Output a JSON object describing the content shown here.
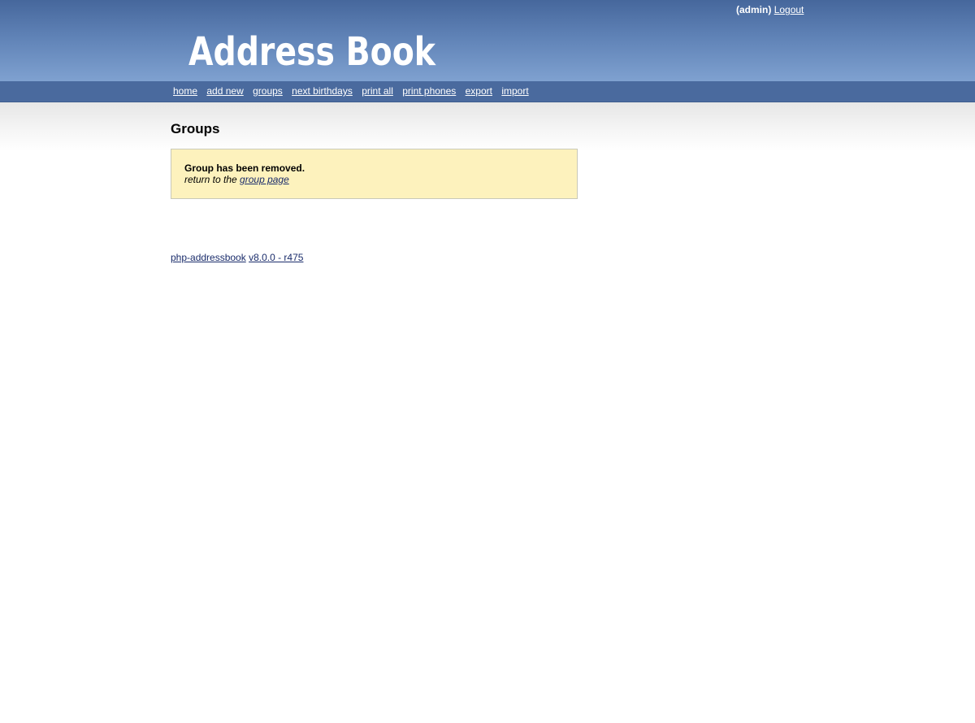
{
  "header": {
    "user": "(admin)",
    "logout_label": "Logout",
    "logo_text": "Address Book"
  },
  "nav": {
    "items": [
      {
        "label": "home"
      },
      {
        "label": "add new"
      },
      {
        "label": "groups"
      },
      {
        "label": "next birthdays"
      },
      {
        "label": "print all"
      },
      {
        "label": "print phones"
      },
      {
        "label": "export"
      },
      {
        "label": "import"
      }
    ]
  },
  "main": {
    "title": "Groups",
    "message": "Group has been removed.",
    "return_prefix": "return to the ",
    "return_link": "group page"
  },
  "footer": {
    "app_link": "php-addressbook",
    "version_link": "v8.0.0 - r475"
  },
  "colors": {
    "header_top": "#46679c",
    "header_bottom": "#7fa1d0",
    "navbar": "#4a6a9e",
    "message_bg": "#fdf2bd",
    "link": "#1a2c6b"
  }
}
